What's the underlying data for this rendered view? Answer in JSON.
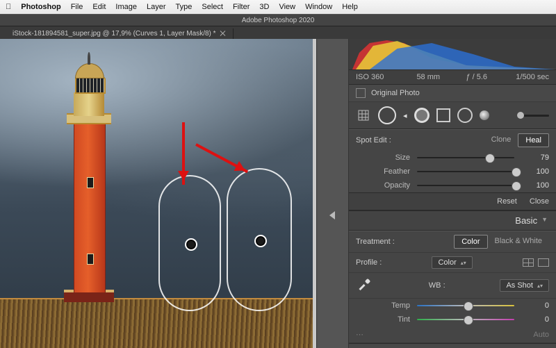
{
  "menubar": {
    "app": "Photoshop",
    "items": [
      "File",
      "Edit",
      "Image",
      "Layer",
      "Type",
      "Select",
      "Filter",
      "3D",
      "View",
      "Window",
      "Help"
    ]
  },
  "titlebar": "Adobe Photoshop 2020",
  "tab": {
    "label": "iStock-181894581_super.jpg @ 17,9% (Curves 1, Layer Mask/8) *"
  },
  "info": {
    "iso": "ISO 360",
    "focal": "58 mm",
    "aperture": "ƒ / 5.6",
    "shutter": "1/500 sec"
  },
  "original_photo_label": "Original Photo",
  "spot": {
    "title": "Spot Edit :",
    "modes": {
      "clone": "Clone",
      "heal": "Heal"
    },
    "size": {
      "label": "Size",
      "value": "79",
      "pos": 0.7
    },
    "feather": {
      "label": "Feather",
      "value": "100",
      "pos": 0.98
    },
    "opacity": {
      "label": "Opacity",
      "value": "100",
      "pos": 0.98
    },
    "reset": "Reset",
    "close": "Close"
  },
  "basic": {
    "title": "Basic",
    "treatment": {
      "label": "Treatment :",
      "color": "Color",
      "bw": "Black & White"
    },
    "profile": {
      "label": "Profile :",
      "value": "Color"
    },
    "wb": {
      "label": "WB :",
      "value": "As Shot"
    },
    "temp": {
      "label": "Temp",
      "value": "0"
    },
    "tint": {
      "label": "Tint",
      "value": "0"
    },
    "auto": "Auto"
  },
  "icons": {
    "grid": "grid-icon",
    "bigcircle": "size-circle-icon",
    "fillcircle": "brush-hardness-icon",
    "square": "rect-icon",
    "thincircle": "oval-icon",
    "sphere": "gradient-spot-icon"
  }
}
